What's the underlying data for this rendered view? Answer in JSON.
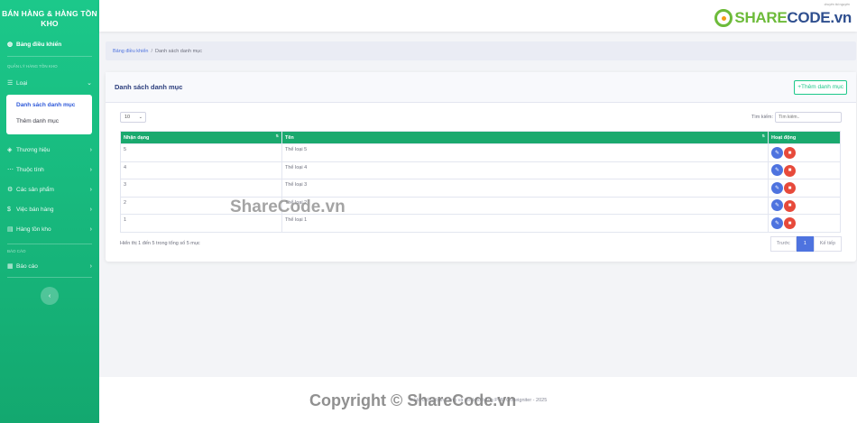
{
  "sidebar": {
    "brand": "BÁN HÀNG & HÀNG TỒN KHO",
    "dashboard": "Bảng điều khiển",
    "heading_inventory": "QUẢN LÝ HÀNG TỒN KHO",
    "loai": "Loại",
    "submenu": [
      "Danh sách danh mục",
      "Thêm danh mục"
    ],
    "thuong_hieu": "Thương hiệu",
    "thuoc_tinh": "Thuộc tính",
    "san_pham": "Các sản phẩm",
    "ban_hang": "Việc bán hàng",
    "ton_kho": "Hàng tồn kho",
    "heading_report": "BÁO CÁO",
    "bao_cao": "Báo cáo",
    "toggle": "‹"
  },
  "topbar": {
    "logo_part1": "SHARE",
    "logo_part2": "CODE.vn",
    "logo_tag": "chuyên tài nguyên"
  },
  "breadcrumb": {
    "home": "Bảng điều khiển",
    "separator": "/",
    "current": "Danh sách danh mục"
  },
  "card": {
    "title": "Danh sách danh mục",
    "add_button": "+Thêm danh mục",
    "length_value": "10",
    "search_label": "Tìm kiếm:",
    "search_placeholder": "Tìm kiếm..",
    "columns": [
      "Nhận dạng",
      "Tên",
      "Hoạt động"
    ],
    "rows": [
      {
        "id": "5",
        "name": "Thể loại 5"
      },
      {
        "id": "4",
        "name": "Thể loại 4"
      },
      {
        "id": "3",
        "name": "Thể loại 3"
      },
      {
        "id": "2",
        "name": "Thể loại 2"
      },
      {
        "id": "1",
        "name": "Thể loại 1"
      }
    ],
    "info": "Hiển thị 1 đến 5 trong tổng số 5 mục",
    "pager": {
      "prev": "Trước",
      "page": "1",
      "next": "Kế tiếp"
    }
  },
  "footer": {
    "text": "© Hệ thống bán hàng và tồn kho bằng PHP Codeigniter - 2025"
  },
  "watermarks": {
    "center": "ShareCode.vn",
    "bottom": "Copyright © ShareCode.vn"
  }
}
